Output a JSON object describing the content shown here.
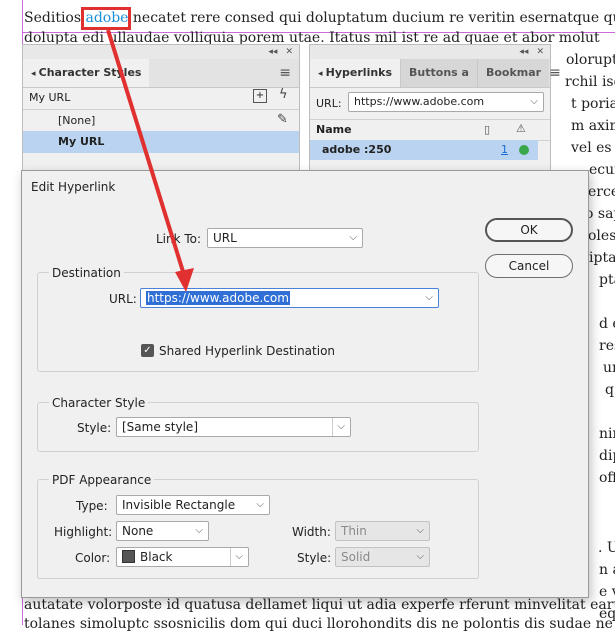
{
  "document": {
    "line1_before": "Seditios ",
    "line1_link": "adobe",
    "line1_after": " necatet rere consed qui doluptatum ducium re veritin esernatque qui",
    "line2": "dolupta edi ullaudae volliquia porem utae. Itatus mil ist re ad quae et abor molut",
    "bottom_line1": "autatate volorposte id quatusa dellamet liqui ut adia experfe rferunt minvelitat earu",
    "bottom_line2": "tolanes simoluptc ssosnicilis dom qui duci llorohondits dis ne polontis dis sudae ne",
    "right_fragments": [
      "olorupta",
      "rchil isqu",
      "t poriam",
      "m axima",
      "vel es aru",
      "ecum, n",
      "ercep",
      "o sape",
      "oles",
      "iptat",
      "pta",
      "d eli",
      "res",
      "ur ac",
      "q",
      "nim",
      "dips",
      "offi",
      ". Uc",
      "n ap",
      "e vic",
      "equi"
    ]
  },
  "character_styles_panel": {
    "tab_label": "Character Styles",
    "current_style": "My URL",
    "items": [
      "[None]",
      "My URL"
    ]
  },
  "hyperlinks_panel": {
    "tabs": [
      "Hyperlinks",
      "Buttons a",
      "Bookmar"
    ],
    "url_label": "URL:",
    "url_value": "https://www.adobe.com",
    "column_name": "Name",
    "row_name": "adobe :250",
    "row_page": "1"
  },
  "dialog": {
    "title": "Edit Hyperlink",
    "link_to_label": "Link To:",
    "link_to_value": "URL",
    "ok_label": "OK",
    "cancel_label": "Cancel",
    "destination_title": "Destination",
    "url_label": "URL:",
    "url_value": "https://www.adobe.com",
    "shared_label": "Shared Hyperlink Destination",
    "shared_checked": true,
    "char_style_title": "Character Style",
    "style_label": "Style:",
    "style_value": "[Same style]",
    "pdf_title": "PDF Appearance",
    "type_label": "Type:",
    "type_value": "Invisible Rectangle",
    "highlight_label": "Highlight:",
    "highlight_value": "None",
    "color_label": "Color:",
    "color_value": "Black",
    "width_label": "Width:",
    "width_value": "Thin",
    "style2_label": "Style:",
    "style2_value": "Solid"
  },
  "colors": {
    "annotation_red": "#e03030",
    "selection_blue": "#2f6fd6",
    "status_green": "#3aa84a"
  }
}
